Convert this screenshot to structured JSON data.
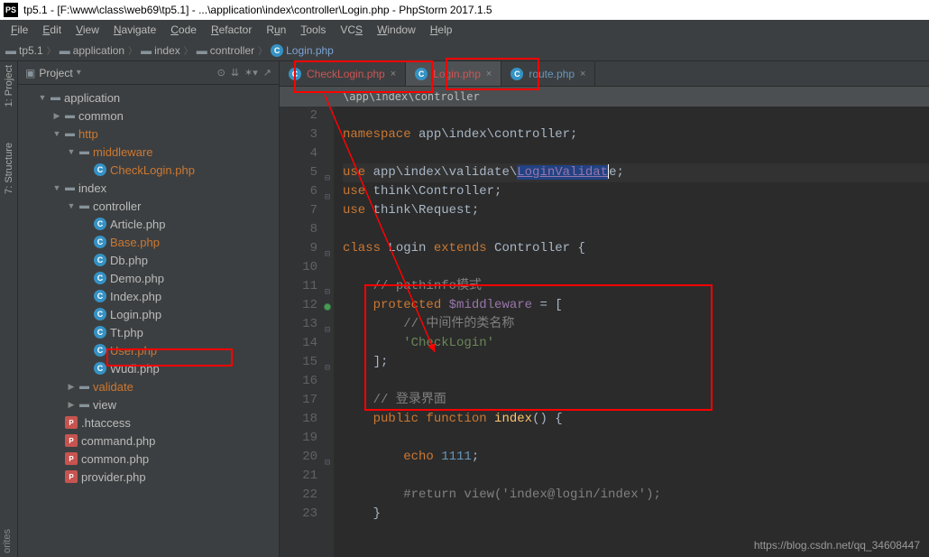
{
  "title": "tp5.1 - [F:\\www\\class\\web69\\tp5.1] - ...\\application\\index\\controller\\Login.php - PhpStorm 2017.1.5",
  "menu": [
    "File",
    "Edit",
    "View",
    "Navigate",
    "Code",
    "Refactor",
    "Run",
    "Tools",
    "VCS",
    "Window",
    "Help"
  ],
  "breadcrumb": [
    {
      "icon": "folder",
      "label": "tp5.1"
    },
    {
      "icon": "folder",
      "label": "application"
    },
    {
      "icon": "folder",
      "label": "index"
    },
    {
      "icon": "folder",
      "label": "controller"
    },
    {
      "icon": "class",
      "label": "Login.php",
      "active": true
    }
  ],
  "panel": {
    "title": "Project"
  },
  "tree": [
    {
      "depth": 1,
      "exp": "▼",
      "icon": "dir",
      "label": "application"
    },
    {
      "depth": 2,
      "exp": "▶",
      "icon": "dir",
      "label": "common"
    },
    {
      "depth": 2,
      "exp": "▼",
      "icon": "dir",
      "label": "http",
      "hot": true
    },
    {
      "depth": 3,
      "exp": "▼",
      "icon": "dir",
      "label": "middleware",
      "hot": true
    },
    {
      "depth": 4,
      "exp": "",
      "icon": "class",
      "label": "CheckLogin.php",
      "hot": true
    },
    {
      "depth": 2,
      "exp": "▼",
      "icon": "dir",
      "label": "index"
    },
    {
      "depth": 3,
      "exp": "▼",
      "icon": "dir",
      "label": "controller"
    },
    {
      "depth": 4,
      "exp": "",
      "icon": "class",
      "label": "Article.php"
    },
    {
      "depth": 4,
      "exp": "",
      "icon": "class",
      "label": "Base.php",
      "hot": true
    },
    {
      "depth": 4,
      "exp": "",
      "icon": "class",
      "label": "Db.php"
    },
    {
      "depth": 4,
      "exp": "",
      "icon": "class",
      "label": "Demo.php"
    },
    {
      "depth": 4,
      "exp": "",
      "icon": "class",
      "label": "Index.php"
    },
    {
      "depth": 4,
      "exp": "",
      "icon": "class",
      "label": "Login.php",
      "boxed": true
    },
    {
      "depth": 4,
      "exp": "",
      "icon": "class",
      "label": "Tt.php"
    },
    {
      "depth": 4,
      "exp": "",
      "icon": "class",
      "label": "User.php",
      "hot": true
    },
    {
      "depth": 4,
      "exp": "",
      "icon": "class",
      "label": "Wudi.php"
    },
    {
      "depth": 3,
      "exp": "▶",
      "icon": "dir",
      "label": "validate",
      "hot": true
    },
    {
      "depth": 3,
      "exp": "▶",
      "icon": "dir",
      "label": "view"
    },
    {
      "depth": 2,
      "exp": "",
      "icon": "php",
      "label": ".htaccess"
    },
    {
      "depth": 2,
      "exp": "",
      "icon": "php",
      "label": "command.php"
    },
    {
      "depth": 2,
      "exp": "",
      "icon": "php",
      "label": "common.php"
    },
    {
      "depth": 2,
      "exp": "",
      "icon": "php",
      "label": "provider.php"
    }
  ],
  "tabs": [
    {
      "icon": "class",
      "label": "CheckLogin.php",
      "cls": "tab-red"
    },
    {
      "icon": "class",
      "label": "Login.php",
      "cls": "tab-red",
      "active": true
    },
    {
      "icon": "class",
      "label": "route.php",
      "cls": "tab-blue"
    }
  ],
  "editor_breadcrumb": "\\app\\index\\controller",
  "lines": [
    2,
    3,
    4,
    5,
    6,
    7,
    8,
    9,
    10,
    11,
    12,
    13,
    14,
    15,
    16,
    17,
    18,
    19,
    20,
    21,
    22,
    23
  ],
  "code": {
    "l3_ns": "namespace",
    "l3_path": " app\\index\\controller;",
    "l5_use": "use",
    "l5_path": " app\\index\\validate\\",
    "l5_cls": "LoginValidat",
    "l5_end": "e;",
    "l6_use": "use",
    "l6_path": " think\\Controller;",
    "l7_use": "use",
    "l7_path": " think\\Request;",
    "l9_class": "class",
    "l9_name": " Login ",
    "l9_ext": "extends",
    "l9_ctl": " Controller {",
    "l11_cmt": "// pathinfo模式",
    "l12_prot": "protected",
    "l12_var": " $middleware ",
    "l12_eq": "= [",
    "l13_cmt": "// 中间件的类名称",
    "l14_str": "'CheckLogin'",
    "l15": "];",
    "l17_cmt": "// 登录界面",
    "l18_pub": "public",
    "l18_fn": " function ",
    "l18_name": "index",
    "l18_end": "() {",
    "l20_echo": "echo",
    "l20_num": " 1111",
    "l20_end": ";",
    "l22_cmt": "#return view('index@login/index');",
    "l23": "}"
  },
  "watermark": "https://blog.csdn.net/qq_34608447",
  "gutter_labs": {
    "project": "1: Project",
    "structure": "7: Structure",
    "fav": "orites"
  }
}
